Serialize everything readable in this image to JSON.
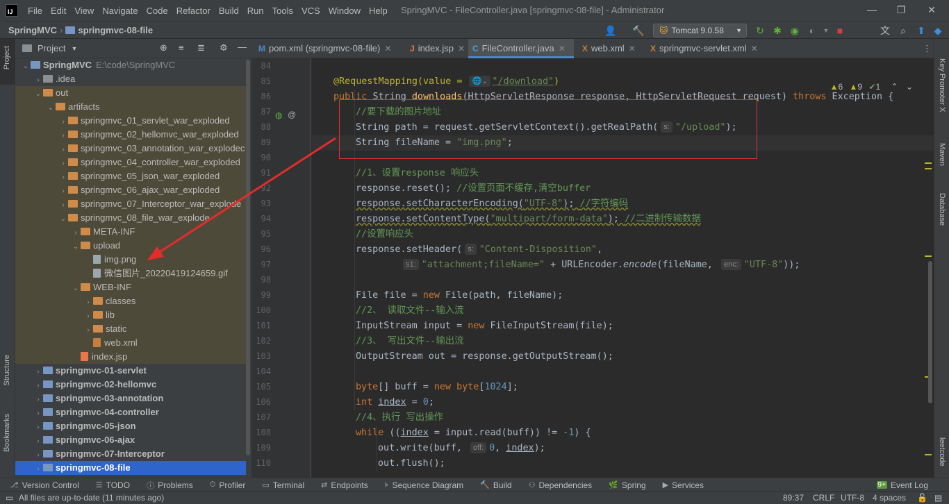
{
  "window": {
    "title": "SpringMVC - FileController.java [springmvc-08-file] - Administrator",
    "menu": [
      "File",
      "Edit",
      "View",
      "Navigate",
      "Code",
      "Refactor",
      "Build",
      "Run",
      "Tools",
      "VCS",
      "Window",
      "Help"
    ]
  },
  "breadcrumb": {
    "root": "SpringMVC",
    "module": "springmvc-08-file"
  },
  "toolbar": {
    "run_config": "Tomcat 9.0.58"
  },
  "left_strip": {
    "project": "Project",
    "structure": "Structure",
    "bookmarks": "Bookmarks"
  },
  "right_strip": {
    "key_promoter": "Key Promoter X",
    "maven": "Maven",
    "database": "Database",
    "leetcode": "leetcode"
  },
  "project_panel": {
    "title": "Project",
    "tree": [
      {
        "label": "SpringMVC",
        "extra": "E:\\code\\SpringMVC",
        "depth": 0,
        "arrow": "down",
        "icon": "folder-blue",
        "bold": true
      },
      {
        "label": ".idea",
        "depth": 1,
        "arrow": "right",
        "icon": "folder-gray"
      },
      {
        "label": "out",
        "depth": 1,
        "arrow": "down",
        "icon": "folder-orange"
      },
      {
        "label": "artifacts",
        "depth": 2,
        "arrow": "down",
        "icon": "folder-orange"
      },
      {
        "label": "springmvc_01_servlet_war_exploded",
        "depth": 3,
        "arrow": "right",
        "icon": "folder-orange"
      },
      {
        "label": "springmvc_02_hellomvc_war_exploded",
        "depth": 3,
        "arrow": "right",
        "icon": "folder-orange"
      },
      {
        "label": "springmvc_03_annotation_war_explodec",
        "depth": 3,
        "arrow": "right",
        "icon": "folder-orange"
      },
      {
        "label": "springmvc_04_controller_war_exploded",
        "depth": 3,
        "arrow": "right",
        "icon": "folder-orange"
      },
      {
        "label": "springmvc_05_json_war_exploded",
        "depth": 3,
        "arrow": "right",
        "icon": "folder-orange"
      },
      {
        "label": "springmvc_06_ajax_war_exploded",
        "depth": 3,
        "arrow": "right",
        "icon": "folder-orange"
      },
      {
        "label": "springmvc_07_Interceptor_war_explode",
        "depth": 3,
        "arrow": "right",
        "icon": "folder-orange"
      },
      {
        "label": "springmvc_08_file_war_explode",
        "depth": 3,
        "arrow": "down",
        "icon": "folder-orange"
      },
      {
        "label": "META-INF",
        "depth": 4,
        "arrow": "right",
        "icon": "folder-orange"
      },
      {
        "label": "upload",
        "depth": 4,
        "arrow": "down",
        "icon": "folder-orange"
      },
      {
        "label": "img.png",
        "depth": 5,
        "arrow": "",
        "icon": "file"
      },
      {
        "label": "微信图片_20220419124659.gif",
        "depth": 5,
        "arrow": "",
        "icon": "file"
      },
      {
        "label": "WEB-INF",
        "depth": 4,
        "arrow": "down",
        "icon": "folder-orange"
      },
      {
        "label": "classes",
        "depth": 5,
        "arrow": "right",
        "icon": "folder-orange"
      },
      {
        "label": "lib",
        "depth": 5,
        "arrow": "right",
        "icon": "folder-orange"
      },
      {
        "label": "static",
        "depth": 5,
        "arrow": "right",
        "icon": "folder-orange"
      },
      {
        "label": "web.xml",
        "depth": 5,
        "arrow": "",
        "icon": "file-xml"
      },
      {
        "label": "index.jsp",
        "depth": 4,
        "arrow": "",
        "icon": "file-jsp"
      },
      {
        "label": "springmvc-01-servlet",
        "depth": 1,
        "arrow": "right",
        "icon": "folder-blue",
        "bold": true
      },
      {
        "label": "springmvc-02-hellomvc",
        "depth": 1,
        "arrow": "right",
        "icon": "folder-blue",
        "bold": true
      },
      {
        "label": "springmvc-03-annotation",
        "depth": 1,
        "arrow": "right",
        "icon": "folder-blue",
        "bold": true
      },
      {
        "label": "springmvc-04-controller",
        "depth": 1,
        "arrow": "right",
        "icon": "folder-blue",
        "bold": true
      },
      {
        "label": "springmvc-05-json",
        "depth": 1,
        "arrow": "right",
        "icon": "folder-blue",
        "bold": true
      },
      {
        "label": "springmvc-06-ajax",
        "depth": 1,
        "arrow": "right",
        "icon": "folder-blue",
        "bold": true
      },
      {
        "label": "springmvc-07-Interceptor",
        "depth": 1,
        "arrow": "right",
        "icon": "folder-blue",
        "bold": true
      },
      {
        "label": "springmvc-08-file",
        "depth": 1,
        "arrow": "right",
        "icon": "folder-blue",
        "bold": true,
        "selected": true
      }
    ]
  },
  "editor_tabs": [
    {
      "label": "pom.xml (springmvc-08-file)",
      "icon": "m"
    },
    {
      "label": "index.jsp",
      "icon": "jsp"
    },
    {
      "label": "FileController.java",
      "icon": "c",
      "active": true
    },
    {
      "label": "web.xml",
      "icon": "xml"
    },
    {
      "label": "springmvc-servlet.xml",
      "icon": "xml"
    }
  ],
  "inspections": {
    "warnings": "6",
    "weak_warnings": "9",
    "typos": "1"
  },
  "code": {
    "line_numbers": [
      "84",
      "85",
      "86",
      "87",
      "88",
      "89",
      "90",
      "91",
      "92",
      "93",
      "94",
      "95",
      "96",
      "97",
      "98",
      "99",
      "100",
      "101",
      "102",
      "103",
      "104",
      "105",
      "106",
      "107",
      "108",
      "109",
      "110"
    ],
    "l85_ann": "@RequestMapping(value = ",
    "l85_str": "\"/download\"",
    "l85_end": ")",
    "l86_a": "public ",
    "l86_b": "String ",
    "l86_fn": "downloads",
    "l86_c": "(HttpServletResponse response, HttpServletRequest request) ",
    "l86_kw": "throws ",
    "l86_d": "Exception {",
    "l87": "//要下载的图片地址",
    "l88_a": "String path = request.getServletContext().getRealPath(",
    "l88_hint": "s:",
    "l88_str": "\"/upload\"",
    "l88_end": ");",
    "l89_a": "String fileName = ",
    "l89_str": "\"img.png\"",
    "l89_end": ";",
    "l91": "//1、设置response 响应头",
    "l92_a": "response.reset(); ",
    "l92_cm": "//设置页面不缓存,清空buffer",
    "l93_a": "response.setCharacterEncoding(",
    "l93_str": "\"UTF-8\"",
    "l93_end": "); ",
    "l93_cm": "//字符编码",
    "l94_a": "response.setContentType(",
    "l94_str": "\"multipart/form-data\"",
    "l94_end": "); ",
    "l94_cm": "//二进制传输数据",
    "l95": "//设置响应头",
    "l96_a": "response.setHeader(",
    "l96_hint": "s:",
    "l96_str": "\"Content-Disposition\"",
    "l96_end": ",",
    "l97_hint": "s1:",
    "l97_str": "\"attachment;fileName=\"",
    "l97_a": " + URLEncoder.",
    "l97_it": "encode",
    "l97_b": "(fileName, ",
    "l97_hint2": "enc:",
    "l97_str2": "\"UTF-8\"",
    "l97_end": "));",
    "l99_a": "File file = ",
    "l99_kw": "new ",
    "l99_b": "File(path, fileName);",
    "l100": "//2、 读取文件--输入流",
    "l101_a": "InputStream input = ",
    "l101_kw": "new ",
    "l101_b": "FileInputStream(file);",
    "l102": "//3、 写出文件--输出流",
    "l103": "OutputStream out = response.getOutputStream();",
    "l105_kw": "byte",
    "l105_a": "[] buff = ",
    "l105_kw2": "new ",
    "l105_kw3": "byte",
    "l105_b": "[",
    "l105_num": "1024",
    "l105_c": "];",
    "l106_kw": "int ",
    "l106_v": "index",
    "l106_a": " = ",
    "l106_num": "0",
    "l106_b": ";",
    "l107": "//4、执行 写出操作",
    "l108_kw": "while ",
    "l108_a": "((",
    "l108_v": "index",
    "l108_b": " = input.read(buff)) != ",
    "l108_num": "-1",
    "l108_c": ") {",
    "l109_a": "out.write(buff, ",
    "l109_hint": "off:",
    "l109_num": "0",
    "l109_b": ", ",
    "l109_v": "index",
    "l109_c": ");",
    "l110": "out.flush();"
  },
  "bottom_tools": [
    "Version Control",
    "TODO",
    "Problems",
    "Profiler",
    "Terminal",
    "Endpoints",
    "Sequence Diagram",
    "Build",
    "Dependencies",
    "Spring",
    "Services",
    "Event Log"
  ],
  "event_badge": "9+",
  "status": {
    "message": "All files are up-to-date (11 minutes ago)",
    "position": "89:37",
    "line_sep": "CRLF",
    "encoding": "UTF-8",
    "indent": "4 spaces"
  }
}
